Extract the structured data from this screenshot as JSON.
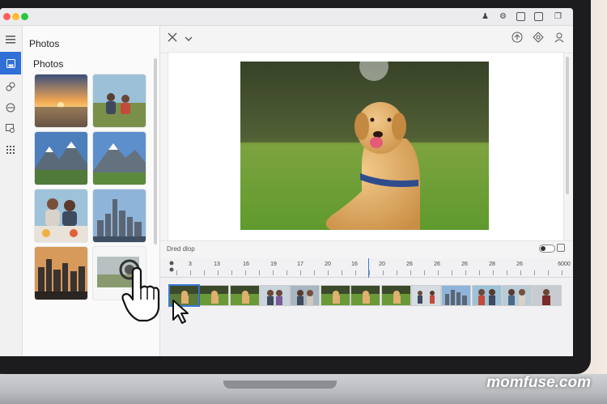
{
  "app": {
    "sidebar_title": "Photos",
    "library_title": "Photos"
  },
  "drop_area": {
    "label": "Dred dlop"
  },
  "timeline": {
    "tick_labels": [
      "3",
      "13",
      "16",
      "19",
      "17",
      "20",
      "16",
      "20",
      "26",
      "26",
      "26",
      "28",
      "26",
      "6000"
    ]
  },
  "watermark": "momfuse.com",
  "colors": {
    "accent": "#2f6fd6",
    "selection": "#3a7bd5"
  },
  "icons": {
    "rail": [
      "menu-icon",
      "save-icon",
      "link-icon",
      "tag-icon",
      "search-icon",
      "grid-icon"
    ],
    "toolbar_left": [
      "wand-icon",
      "chevron-down-icon"
    ],
    "toolbar_right": [
      "upload-icon",
      "diamond-icon",
      "person-icon"
    ]
  }
}
